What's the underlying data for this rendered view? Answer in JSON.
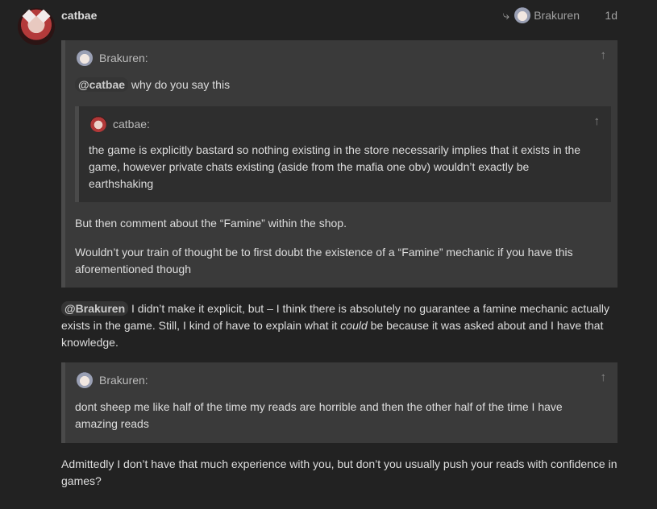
{
  "post": {
    "author": "catbae",
    "reply_to": "Brakuren",
    "date": "1d",
    "reply_arrow": "⤷"
  },
  "quote1": {
    "author": "Brakuren:",
    "mention": "@catbae",
    "line1": "why do you say this",
    "nested": {
      "author": "catbae:",
      "text": "the game is explicitly bastard so nothing existing in the store necessarily implies that it exists in the game, however private chats existing (aside from the mafia one obv) wouldn’t exactly be earthshaking"
    },
    "para2": "But then comment about the “Famine” within the shop.",
    "para3": "Wouldn’t your train of thought be to first doubt the existence of a “Famine” mechanic if you have this aforementioned though"
  },
  "reply1": {
    "mention": "@Brakuren",
    "text_a": " I didn’t make it explicit, but – I think there is absolutely no guarantee a famine mechanic actually exists in the game. Still, I kind of have to explain what it ",
    "text_italic": "could",
    "text_b": " be because it was asked about and I have that knowledge."
  },
  "quote2": {
    "author": "Brakuren:",
    "text": "dont sheep me like half of the time my reads are horrible and then the other half of the time I have amazing reads"
  },
  "reply2": {
    "text": "Admittedly I don’t have that much experience with you, but don’t you usually push your reads with confidence in games?"
  },
  "icons": {
    "up_arrow": "↑"
  },
  "colors": {
    "background": "#222222",
    "quote_bg": "#3a3a3a",
    "nested_quote_bg": "#2e2e2e",
    "text": "#dddddd",
    "muted": "#a0a0a0"
  }
}
